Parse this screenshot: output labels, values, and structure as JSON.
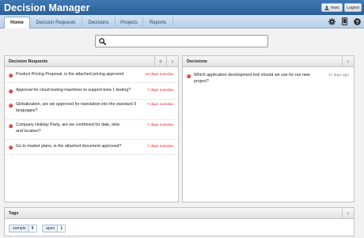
{
  "app": {
    "title": "Decision Manager",
    "user": "marc",
    "logout_label": "Logout"
  },
  "tabs": [
    {
      "label": "Home",
      "active": true
    },
    {
      "label": "Decision Requests",
      "active": false
    },
    {
      "label": "Decisions",
      "active": false
    },
    {
      "label": "Projects",
      "active": false
    },
    {
      "label": "Reports",
      "active": false
    }
  ],
  "toolbar_icons": [
    "gear-icon",
    "phone-icon",
    "help-icon"
  ],
  "search": {
    "placeholder": "",
    "value": ""
  },
  "decision_requests": {
    "title": "Decision Requests",
    "items": [
      {
        "text": "Product Pricing Proposal, is the attached pricing approved",
        "status": "16 days overdue"
      },
      {
        "text": "Approval for cloud testing machines to support beta 1 testing?",
        "status": "7 days overdue"
      },
      {
        "text": "Globalization, are we approved for translation into the standard 9 languages?",
        "status": "7 days overdue"
      },
      {
        "text": "Company Holiday Party, are we confirmed for date, time and location?",
        "status": "7 days overdue"
      },
      {
        "text": "Go to market plans, is the attached document approved?",
        "status": "7 days overdue"
      }
    ]
  },
  "decisions": {
    "title": "Decisions",
    "items": [
      {
        "text": "Which application development tool should we use for our new project?",
        "age": "17 days ago"
      }
    ]
  },
  "tags": {
    "title": "Tags",
    "items": [
      {
        "name": "sample",
        "count": "6"
      },
      {
        "name": "apex",
        "count": "1"
      }
    ]
  },
  "colors": {
    "brand": "#2c5f98",
    "overdue": "#e02020",
    "status_dot": "#c0271f"
  }
}
